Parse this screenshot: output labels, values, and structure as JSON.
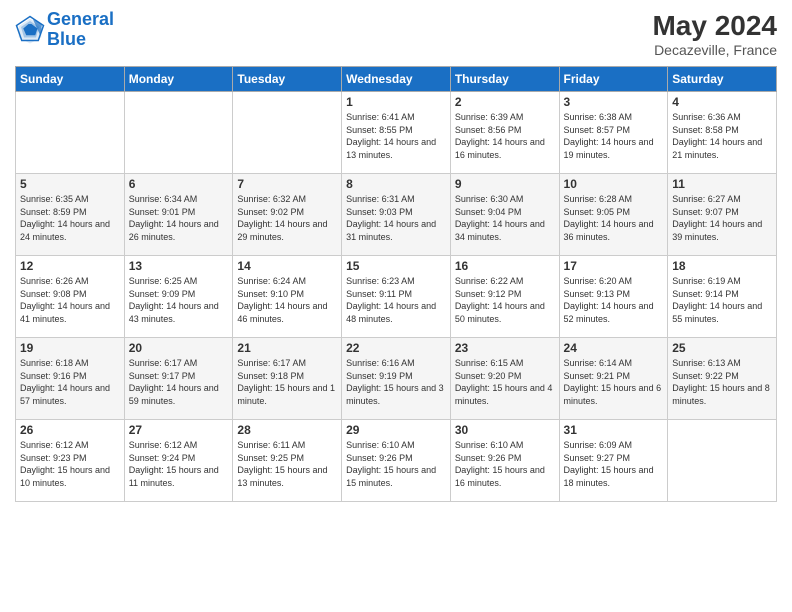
{
  "logo": {
    "line1": "General",
    "line2": "Blue"
  },
  "title": "May 2024",
  "location": "Decazeville, France",
  "days_header": [
    "Sunday",
    "Monday",
    "Tuesday",
    "Wednesday",
    "Thursday",
    "Friday",
    "Saturday"
  ],
  "weeks": [
    [
      {
        "day": "",
        "sunrise": "",
        "sunset": "",
        "daylight": ""
      },
      {
        "day": "",
        "sunrise": "",
        "sunset": "",
        "daylight": ""
      },
      {
        "day": "",
        "sunrise": "",
        "sunset": "",
        "daylight": ""
      },
      {
        "day": "1",
        "sunrise": "Sunrise: 6:41 AM",
        "sunset": "Sunset: 8:55 PM",
        "daylight": "Daylight: 14 hours and 13 minutes."
      },
      {
        "day": "2",
        "sunrise": "Sunrise: 6:39 AM",
        "sunset": "Sunset: 8:56 PM",
        "daylight": "Daylight: 14 hours and 16 minutes."
      },
      {
        "day": "3",
        "sunrise": "Sunrise: 6:38 AM",
        "sunset": "Sunset: 8:57 PM",
        "daylight": "Daylight: 14 hours and 19 minutes."
      },
      {
        "day": "4",
        "sunrise": "Sunrise: 6:36 AM",
        "sunset": "Sunset: 8:58 PM",
        "daylight": "Daylight: 14 hours and 21 minutes."
      }
    ],
    [
      {
        "day": "5",
        "sunrise": "Sunrise: 6:35 AM",
        "sunset": "Sunset: 8:59 PM",
        "daylight": "Daylight: 14 hours and 24 minutes."
      },
      {
        "day": "6",
        "sunrise": "Sunrise: 6:34 AM",
        "sunset": "Sunset: 9:01 PM",
        "daylight": "Daylight: 14 hours and 26 minutes."
      },
      {
        "day": "7",
        "sunrise": "Sunrise: 6:32 AM",
        "sunset": "Sunset: 9:02 PM",
        "daylight": "Daylight: 14 hours and 29 minutes."
      },
      {
        "day": "8",
        "sunrise": "Sunrise: 6:31 AM",
        "sunset": "Sunset: 9:03 PM",
        "daylight": "Daylight: 14 hours and 31 minutes."
      },
      {
        "day": "9",
        "sunrise": "Sunrise: 6:30 AM",
        "sunset": "Sunset: 9:04 PM",
        "daylight": "Daylight: 14 hours and 34 minutes."
      },
      {
        "day": "10",
        "sunrise": "Sunrise: 6:28 AM",
        "sunset": "Sunset: 9:05 PM",
        "daylight": "Daylight: 14 hours and 36 minutes."
      },
      {
        "day": "11",
        "sunrise": "Sunrise: 6:27 AM",
        "sunset": "Sunset: 9:07 PM",
        "daylight": "Daylight: 14 hours and 39 minutes."
      }
    ],
    [
      {
        "day": "12",
        "sunrise": "Sunrise: 6:26 AM",
        "sunset": "Sunset: 9:08 PM",
        "daylight": "Daylight: 14 hours and 41 minutes."
      },
      {
        "day": "13",
        "sunrise": "Sunrise: 6:25 AM",
        "sunset": "Sunset: 9:09 PM",
        "daylight": "Daylight: 14 hours and 43 minutes."
      },
      {
        "day": "14",
        "sunrise": "Sunrise: 6:24 AM",
        "sunset": "Sunset: 9:10 PM",
        "daylight": "Daylight: 14 hours and 46 minutes."
      },
      {
        "day": "15",
        "sunrise": "Sunrise: 6:23 AM",
        "sunset": "Sunset: 9:11 PM",
        "daylight": "Daylight: 14 hours and 48 minutes."
      },
      {
        "day": "16",
        "sunrise": "Sunrise: 6:22 AM",
        "sunset": "Sunset: 9:12 PM",
        "daylight": "Daylight: 14 hours and 50 minutes."
      },
      {
        "day": "17",
        "sunrise": "Sunrise: 6:20 AM",
        "sunset": "Sunset: 9:13 PM",
        "daylight": "Daylight: 14 hours and 52 minutes."
      },
      {
        "day": "18",
        "sunrise": "Sunrise: 6:19 AM",
        "sunset": "Sunset: 9:14 PM",
        "daylight": "Daylight: 14 hours and 55 minutes."
      }
    ],
    [
      {
        "day": "19",
        "sunrise": "Sunrise: 6:18 AM",
        "sunset": "Sunset: 9:16 PM",
        "daylight": "Daylight: 14 hours and 57 minutes."
      },
      {
        "day": "20",
        "sunrise": "Sunrise: 6:17 AM",
        "sunset": "Sunset: 9:17 PM",
        "daylight": "Daylight: 14 hours and 59 minutes."
      },
      {
        "day": "21",
        "sunrise": "Sunrise: 6:17 AM",
        "sunset": "Sunset: 9:18 PM",
        "daylight": "Daylight: 15 hours and 1 minute."
      },
      {
        "day": "22",
        "sunrise": "Sunrise: 6:16 AM",
        "sunset": "Sunset: 9:19 PM",
        "daylight": "Daylight: 15 hours and 3 minutes."
      },
      {
        "day": "23",
        "sunrise": "Sunrise: 6:15 AM",
        "sunset": "Sunset: 9:20 PM",
        "daylight": "Daylight: 15 hours and 4 minutes."
      },
      {
        "day": "24",
        "sunrise": "Sunrise: 6:14 AM",
        "sunset": "Sunset: 9:21 PM",
        "daylight": "Daylight: 15 hours and 6 minutes."
      },
      {
        "day": "25",
        "sunrise": "Sunrise: 6:13 AM",
        "sunset": "Sunset: 9:22 PM",
        "daylight": "Daylight: 15 hours and 8 minutes."
      }
    ],
    [
      {
        "day": "26",
        "sunrise": "Sunrise: 6:12 AM",
        "sunset": "Sunset: 9:23 PM",
        "daylight": "Daylight: 15 hours and 10 minutes."
      },
      {
        "day": "27",
        "sunrise": "Sunrise: 6:12 AM",
        "sunset": "Sunset: 9:24 PM",
        "daylight": "Daylight: 15 hours and 11 minutes."
      },
      {
        "day": "28",
        "sunrise": "Sunrise: 6:11 AM",
        "sunset": "Sunset: 9:25 PM",
        "daylight": "Daylight: 15 hours and 13 minutes."
      },
      {
        "day": "29",
        "sunrise": "Sunrise: 6:10 AM",
        "sunset": "Sunset: 9:26 PM",
        "daylight": "Daylight: 15 hours and 15 minutes."
      },
      {
        "day": "30",
        "sunrise": "Sunrise: 6:10 AM",
        "sunset": "Sunset: 9:26 PM",
        "daylight": "Daylight: 15 hours and 16 minutes."
      },
      {
        "day": "31",
        "sunrise": "Sunrise: 6:09 AM",
        "sunset": "Sunset: 9:27 PM",
        "daylight": "Daylight: 15 hours and 18 minutes."
      },
      {
        "day": "",
        "sunrise": "",
        "sunset": "",
        "daylight": ""
      }
    ]
  ]
}
